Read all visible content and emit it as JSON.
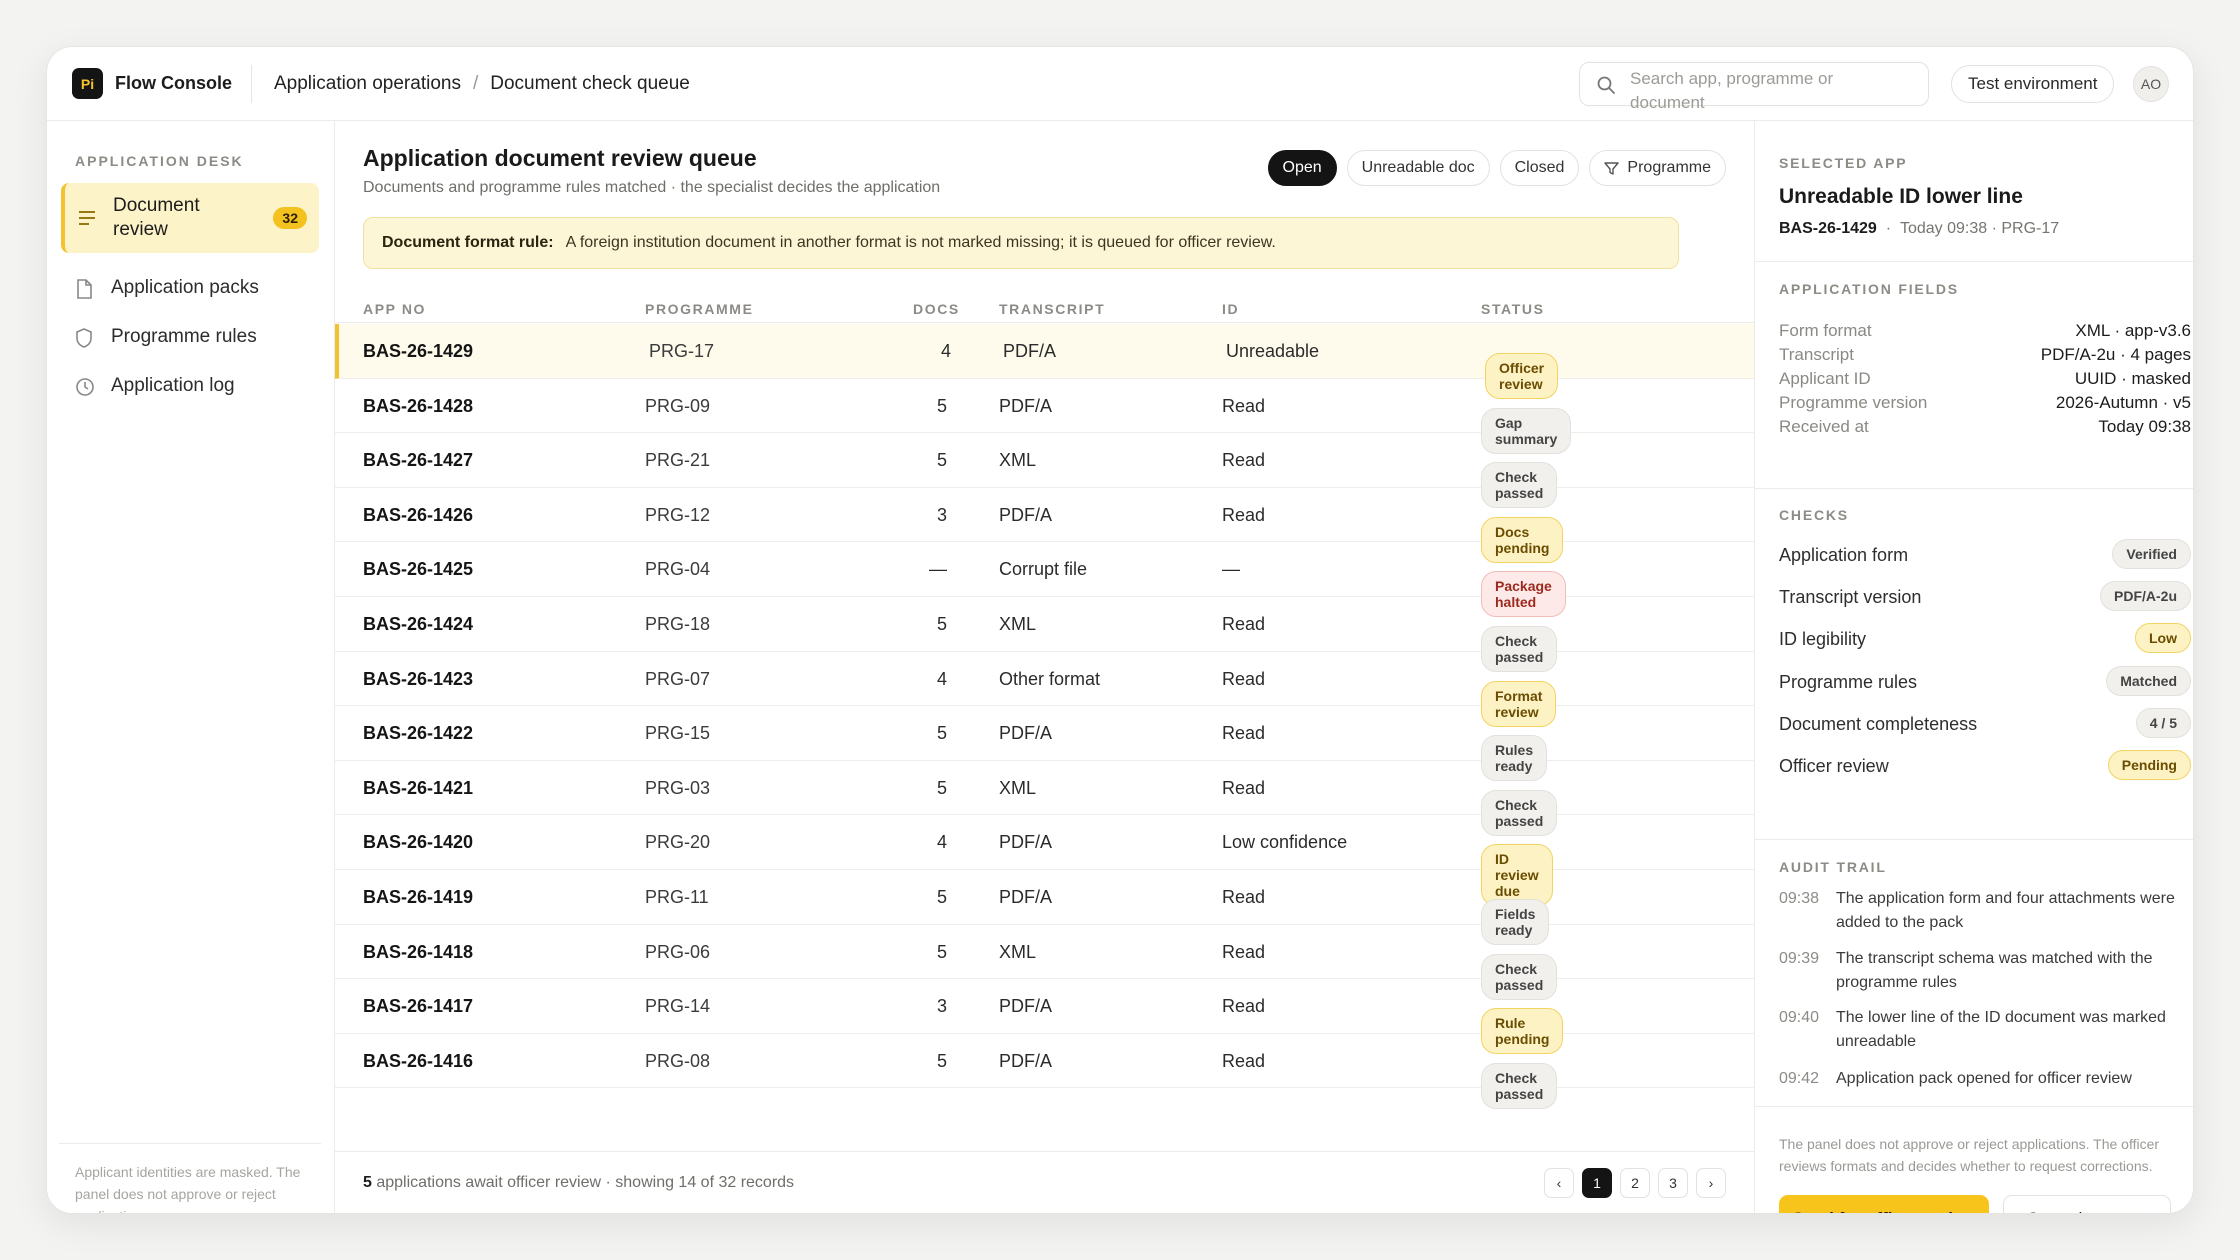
{
  "app": {
    "logo": "Pi",
    "name": "Flow Console"
  },
  "breadcrumb": [
    "Application operations",
    "Document check queue"
  ],
  "search": {
    "placeholder": "Search app, programme or document"
  },
  "environment": "Test environment",
  "avatar": "AO",
  "sidebar": {
    "title": "APPLICATION DESK",
    "items": [
      {
        "label": "Document review",
        "badge": "32",
        "icon": "list-icon"
      },
      {
        "label": "Application packs",
        "icon": "file-icon"
      },
      {
        "label": "Programme rules",
        "icon": "shield-icon"
      },
      {
        "label": "Application log",
        "icon": "clock-icon"
      }
    ],
    "footer": "Applicant identities are masked. The panel does not approve or reject applications."
  },
  "main": {
    "title": "Application document review queue",
    "subtitle": "Documents and programme rules matched · the specialist decides the application",
    "filters": [
      "Open",
      "Unreadable doc",
      "Closed",
      "Programme"
    ],
    "notice_label": "Document format rule:",
    "notice_text": "A foreign institution document in another format is not marked missing; it is queued for officer review.",
    "columns": [
      "APP NO",
      "PROGRAMME",
      "DOCS",
      "TRANSCRIPT",
      "ID",
      "STATUS"
    ],
    "rows": [
      {
        "app": "BAS-26-1429",
        "prg": "PRG-17",
        "docs": "4",
        "transcript": "PDF/A",
        "id": "Unreadable",
        "status": "Officer review"
      },
      {
        "app": "BAS-26-1428",
        "prg": "PRG-09",
        "docs": "5",
        "transcript": "PDF/A",
        "id": "Read",
        "status": "Gap summary"
      },
      {
        "app": "BAS-26-1427",
        "prg": "PRG-21",
        "docs": "5",
        "transcript": "XML",
        "id": "Read",
        "status": "Check passed"
      },
      {
        "app": "BAS-26-1426",
        "prg": "PRG-12",
        "docs": "3",
        "transcript": "PDF/A",
        "id": "Read",
        "status": "Docs pending"
      },
      {
        "app": "BAS-26-1425",
        "prg": "PRG-04",
        "docs": "—",
        "transcript": "Corrupt file",
        "id": "—",
        "status": "Package halted"
      },
      {
        "app": "BAS-26-1424",
        "prg": "PRG-18",
        "docs": "5",
        "transcript": "XML",
        "id": "Read",
        "status": "Check passed"
      },
      {
        "app": "BAS-26-1423",
        "prg": "PRG-07",
        "docs": "4",
        "transcript": "Other format",
        "id": "Read",
        "status": "Format review"
      },
      {
        "app": "BAS-26-1422",
        "prg": "PRG-15",
        "docs": "5",
        "transcript": "PDF/A",
        "id": "Read",
        "status": "Rules ready"
      },
      {
        "app": "BAS-26-1421",
        "prg": "PRG-03",
        "docs": "5",
        "transcript": "XML",
        "id": "Read",
        "status": "Check passed"
      },
      {
        "app": "BAS-26-1420",
        "prg": "PRG-20",
        "docs": "4",
        "transcript": "PDF/A",
        "id": "Low confidence",
        "status": "ID review due"
      },
      {
        "app": "BAS-26-1419",
        "prg": "PRG-11",
        "docs": "5",
        "transcript": "PDF/A",
        "id": "Read",
        "status": "Fields ready"
      },
      {
        "app": "BAS-26-1418",
        "prg": "PRG-06",
        "docs": "5",
        "transcript": "XML",
        "id": "Read",
        "status": "Check passed"
      },
      {
        "app": "BAS-26-1417",
        "prg": "PRG-14",
        "docs": "3",
        "transcript": "PDF/A",
        "id": "Read",
        "status": "Rule pending"
      },
      {
        "app": "BAS-26-1416",
        "prg": "PRG-08",
        "docs": "5",
        "transcript": "PDF/A",
        "id": "Read",
        "status": "Check passed"
      }
    ],
    "footer_count": "5",
    "footer_text": "applications await officer review · showing 14 of 32 records",
    "pages": [
      "‹",
      "1",
      "2",
      "3",
      "›"
    ]
  },
  "panel": {
    "selected_title": "SELECTED APP",
    "app_title": "Unreadable ID lower line",
    "app_no": "BAS-26-1429",
    "app_meta": "Today 09:38 · PRG-17",
    "fields_title": "APPLICATION FIELDS",
    "fields": [
      {
        "k": "Form format",
        "v": "XML · app-v3.6"
      },
      {
        "k": "Transcript",
        "v": "PDF/A-2u · 4 pages"
      },
      {
        "k": "Applicant ID",
        "v": "UUID · masked"
      },
      {
        "k": "Programme version",
        "v": "2026-Autumn · v5"
      },
      {
        "k": "Received at",
        "v": "Today 09:38"
      }
    ],
    "checks_title": "CHECKS",
    "checks": [
      {
        "k": "Application form",
        "v": "Verified"
      },
      {
        "k": "Transcript version",
        "v": "PDF/A-2u"
      },
      {
        "k": "ID legibility",
        "v": "Low"
      },
      {
        "k": "Programme rules",
        "v": "Matched"
      },
      {
        "k": "Document completeness",
        "v": "4 / 5"
      },
      {
        "k": "Officer review",
        "v": "Pending"
      }
    ],
    "audit_title": "AUDIT TRAIL",
    "audit": [
      {
        "t": "09:38",
        "d": "The application form and four attachments were added to the pack"
      },
      {
        "t": "09:39",
        "d": "The transcript schema was matched with the programme rules"
      },
      {
        "t": "09:40",
        "d": "The lower line of the ID document was marked unreadable"
      },
      {
        "t": "09:42",
        "d": "Application pack opened for officer review"
      }
    ],
    "note": "The panel does not approve or reject applications. The officer reviews formats and decides whether to request corrections.",
    "primary_button": "Send for officer review",
    "secondary_button": "Open document"
  },
  "colors": {
    "accent": "#f7c41b",
    "dark": "#141414",
    "danger": "#9c2a1f"
  }
}
